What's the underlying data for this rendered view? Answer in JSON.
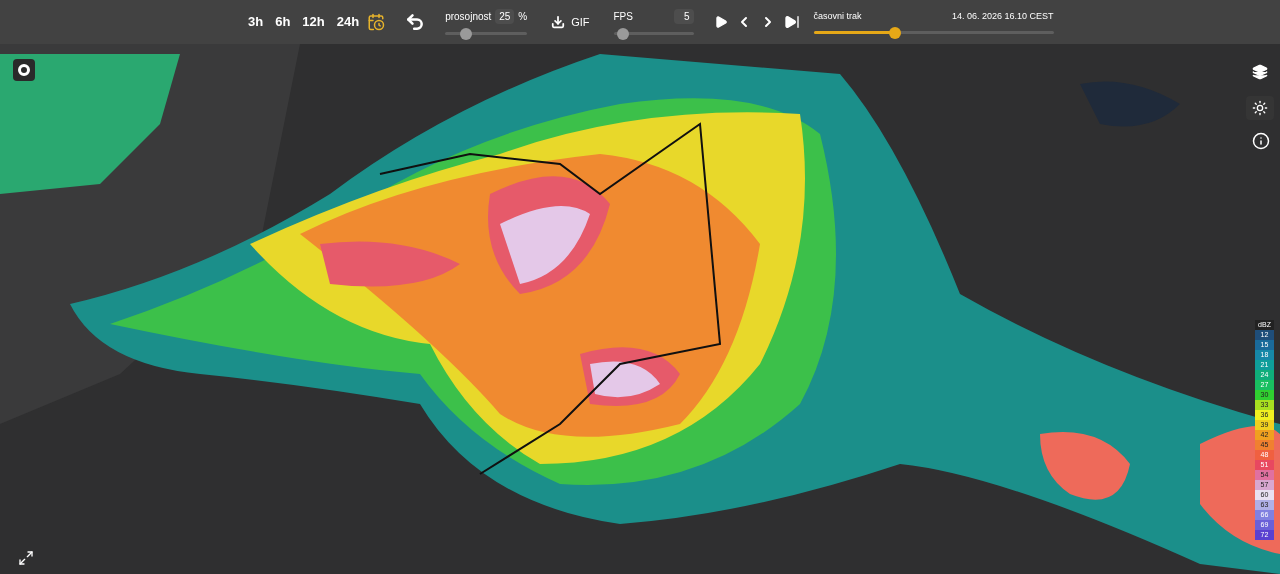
{
  "toolbar": {
    "ranges": [
      {
        "label": "3h"
      },
      {
        "label": "6h"
      },
      {
        "label": "12h"
      },
      {
        "label": "24h"
      }
    ],
    "opacity": {
      "label": "prosojnost",
      "value": "25",
      "unit": "%",
      "level": 0.25
    },
    "gif": {
      "label": "GIF"
    },
    "fps": {
      "label": "FPS",
      "value": "5",
      "level": 0.12
    },
    "timeline": {
      "label": "časovni trak",
      "datetime": "14. 06. 2026 16.10 CEST",
      "level": 0.34
    }
  },
  "legend": {
    "unit": "dBZ",
    "entries": [
      {
        "label": "12",
        "color": "#1f4e7a"
      },
      {
        "label": "15",
        "color": "#1a6a9a"
      },
      {
        "label": "18",
        "color": "#1688a8"
      },
      {
        "label": "21",
        "color": "#0e9e9a"
      },
      {
        "label": "24",
        "color": "#0fae7a"
      },
      {
        "label": "27",
        "color": "#19c060"
      },
      {
        "label": "30",
        "color": "#30d030"
      },
      {
        "label": "33",
        "color": "#a8e020"
      },
      {
        "label": "36",
        "color": "#f0f020"
      },
      {
        "label": "39",
        "color": "#f0d020"
      },
      {
        "label": "42",
        "color": "#f0a020"
      },
      {
        "label": "45",
        "color": "#f08030"
      },
      {
        "label": "48",
        "color": "#f06040"
      },
      {
        "label": "51",
        "color": "#e84860"
      },
      {
        "label": "54",
        "color": "#e070a0"
      },
      {
        "label": "57",
        "color": "#d8a8d0"
      },
      {
        "label": "60",
        "color": "#e8e0f0"
      },
      {
        "label": "63",
        "color": "#b0b0e8"
      },
      {
        "label": "66",
        "color": "#8080e0"
      },
      {
        "label": "69",
        "color": "#6a60d8"
      },
      {
        "label": "72",
        "color": "#5a40d0"
      }
    ]
  }
}
